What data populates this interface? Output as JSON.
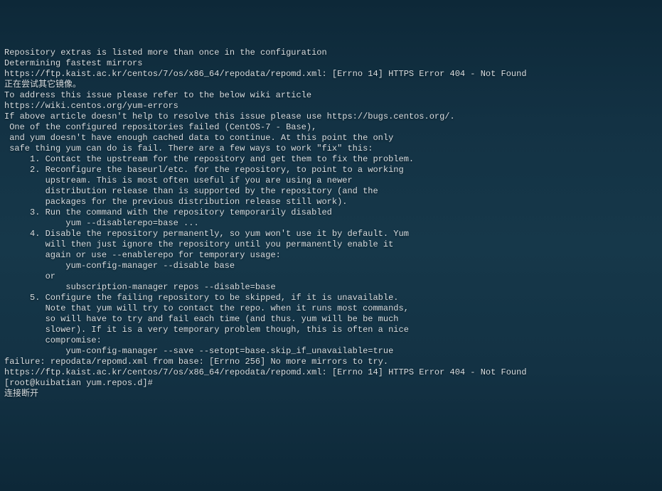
{
  "terminal": {
    "lines": [
      "Repository extras is listed more than once in the configuration",
      "Determining fastest mirrors",
      "https://ftp.kaist.ac.kr/centos/7/os/x86_64/repodata/repomd.xml: [Errno 14] HTTPS Error 404 - Not Found",
      "正在尝试其它镜像。",
      "To address this issue please refer to the below wiki article",
      "",
      "https://wiki.centos.org/yum-errors",
      "",
      "If above article doesn't help to resolve this issue please use https://bugs.centos.org/.",
      "",
      "",
      "",
      " One of the configured repositories failed (CentOS-7 - Base),",
      " and yum doesn't have enough cached data to continue. At this point the only",
      " safe thing yum can do is fail. There are a few ways to work \"fix\" this:",
      "",
      "     1. Contact the upstream for the repository and get them to fix the problem.",
      "",
      "     2. Reconfigure the baseurl/etc. for the repository, to point to a working",
      "        upstream. This is most often useful if you are using a newer",
      "        distribution release than is supported by the repository (and the",
      "        packages for the previous distribution release still work).",
      "",
      "     3. Run the command with the repository temporarily disabled",
      "            yum --disablerepo=base ...",
      "",
      "     4. Disable the repository permanently, so yum won't use it by default. Yum",
      "        will then just ignore the repository until you permanently enable it",
      "        again or use --enablerepo for temporary usage:",
      "",
      "            yum-config-manager --disable base",
      "        or",
      "            subscription-manager repos --disable=base",
      "",
      "     5. Configure the failing repository to be skipped, if it is unavailable.",
      "        Note that yum will try to contact the repo. when it runs most commands,",
      "        so will have to try and fail each time (and thus. yum will be be much",
      "        slower). If it is a very temporary problem though, this is often a nice",
      "        compromise:",
      "",
      "            yum-config-manager --save --setopt=base.skip_if_unavailable=true",
      "",
      "failure: repodata/repomd.xml from base: [Errno 256] No more mirrors to try.",
      "https://ftp.kaist.ac.kr/centos/7/os/x86_64/repodata/repomd.xml: [Errno 14] HTTPS Error 404 - Not Found",
      "[root@kuibatian yum.repos.d]#",
      "连接断开"
    ]
  }
}
